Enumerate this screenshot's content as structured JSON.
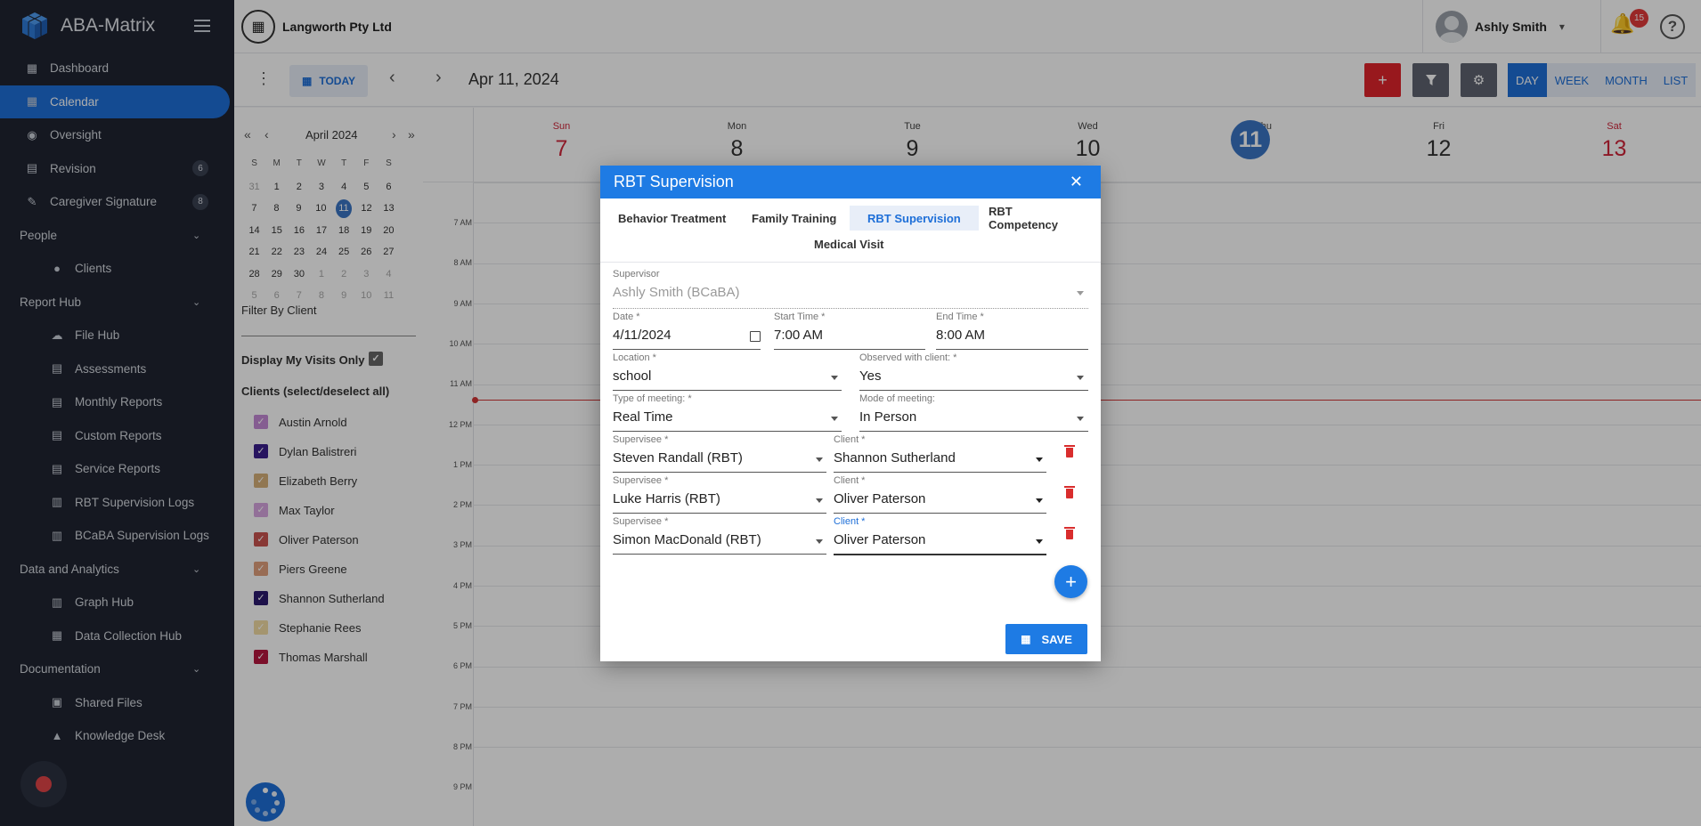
{
  "app": {
    "name": "ABA-Matrix"
  },
  "sidebar": {
    "items": [
      {
        "label": "Dashboard",
        "icon": "dashboard-icon",
        "kind": "top"
      },
      {
        "label": "Calendar",
        "icon": "calendar-icon",
        "kind": "top",
        "active": true
      },
      {
        "label": "Oversight",
        "icon": "eye-icon",
        "kind": "top"
      },
      {
        "label": "Revision",
        "icon": "revision-icon",
        "kind": "top",
        "badge": "6"
      },
      {
        "label": "Caregiver Signature",
        "icon": "signature-icon",
        "kind": "top",
        "badge": "8"
      },
      {
        "label": "People",
        "kind": "section"
      },
      {
        "label": "Clients",
        "icon": "person-icon",
        "kind": "sub"
      },
      {
        "label": "Report Hub",
        "kind": "section"
      },
      {
        "label": "File Hub",
        "icon": "cloud-icon",
        "kind": "sub"
      },
      {
        "label": "Assessments",
        "icon": "assessment-icon",
        "kind": "sub"
      },
      {
        "label": "Monthly Reports",
        "icon": "report-icon",
        "kind": "sub"
      },
      {
        "label": "Custom Reports",
        "icon": "report-icon",
        "kind": "sub"
      },
      {
        "label": "Service Reports",
        "icon": "service-icon",
        "kind": "sub"
      },
      {
        "label": "RBT Supervision Logs",
        "icon": "log-icon",
        "kind": "sub"
      },
      {
        "label": "BCaBA Supervision Logs",
        "icon": "log-icon",
        "kind": "sub"
      },
      {
        "label": "Data and Analytics",
        "kind": "section"
      },
      {
        "label": "Graph Hub",
        "icon": "graph-icon",
        "kind": "sub"
      },
      {
        "label": "Data Collection Hub",
        "icon": "data-icon",
        "kind": "sub"
      },
      {
        "label": "Documentation",
        "kind": "section"
      },
      {
        "label": "Shared Files",
        "icon": "shared-icon",
        "kind": "sub"
      },
      {
        "label": "Knowledge Desk",
        "icon": "knowledge-icon",
        "kind": "sub"
      }
    ]
  },
  "header": {
    "company": "Langworth Pty Ltd",
    "user": "Ashly Smith",
    "notifications": "15"
  },
  "toolbar": {
    "today_label": "TODAY",
    "current_date": "Apr 11, 2024",
    "views": [
      "DAY",
      "WEEK",
      "MONTH",
      "LIST"
    ],
    "selected_view": "DAY"
  },
  "mini_calendar": {
    "title": "April 2024",
    "dow": [
      "S",
      "M",
      "T",
      "W",
      "T",
      "F",
      "S"
    ],
    "weeks": [
      [
        "31",
        "1",
        "2",
        "3",
        "4",
        "5",
        "6"
      ],
      [
        "7",
        "8",
        "9",
        "10",
        "11",
        "12",
        "13"
      ],
      [
        "14",
        "15",
        "16",
        "17",
        "18",
        "19",
        "20"
      ],
      [
        "21",
        "22",
        "23",
        "24",
        "25",
        "26",
        "27"
      ],
      [
        "28",
        "29",
        "30",
        "1",
        "2",
        "3",
        "4"
      ],
      [
        "5",
        "6",
        "7",
        "8",
        "9",
        "10",
        "11"
      ]
    ],
    "selected": "11"
  },
  "filters": {
    "filter_by_client": "Filter By Client",
    "my_visits_label": "Display My Visits Only",
    "clients_header": "Clients (select/deselect all)",
    "clients": [
      {
        "name": "Austin Arnold",
        "color": "#c58ad6",
        "checked": true
      },
      {
        "name": "Dylan Balistreri",
        "color": "#3a1e8c",
        "checked": true
      },
      {
        "name": "Elizabeth Berry",
        "color": "#d6b07a",
        "checked": true
      },
      {
        "name": "Max Taylor",
        "color": "#d8a5e0",
        "checked": true
      },
      {
        "name": "Oliver Paterson",
        "color": "#c9534f",
        "checked": true
      },
      {
        "name": "Piers Greene",
        "color": "#e0a07c",
        "checked": true
      },
      {
        "name": "Shannon Sutherland",
        "color": "#2b1a6e",
        "checked": true
      },
      {
        "name": "Stephanie Rees",
        "color": "#f2dca4",
        "checked": true
      },
      {
        "name": "Thomas Marshall",
        "color": "#b5173f",
        "checked": true
      }
    ]
  },
  "week": {
    "days": [
      {
        "name": "Sun",
        "num": "7",
        "weekend": true
      },
      {
        "name": "Mon",
        "num": "8"
      },
      {
        "name": "Tue",
        "num": "9"
      },
      {
        "name": "Wed",
        "num": "10"
      },
      {
        "name": "Thu",
        "num": "11",
        "today": true
      },
      {
        "name": "Fri",
        "num": "12"
      },
      {
        "name": "Sat",
        "num": "13",
        "weekend": true
      }
    ],
    "hours": [
      "7 AM",
      "8 AM",
      "9 AM",
      "10 AM",
      "11 AM",
      "12 PM",
      "1 PM",
      "2 PM",
      "3 PM",
      "4 PM",
      "5 PM",
      "6 PM",
      "7 PM",
      "8 PM",
      "9 PM"
    ]
  },
  "modal": {
    "title": "RBT Supervision",
    "tabs": [
      "Behavior Treatment",
      "Family Training",
      "RBT Supervision",
      "RBT Competency",
      "Medical Visit"
    ],
    "active_tab": "RBT Supervision",
    "supervisor_label": "Supervisor",
    "supervisor_value": "Ashly Smith (BCaBA)",
    "date_label": "Date *",
    "date_value": "4/11/2024",
    "start_label": "Start Time *",
    "start_value": "7:00 AM",
    "end_label": "End Time *",
    "end_value": "8:00 AM",
    "location_label": "Location *",
    "location_value": "school",
    "observed_label": "Observed with client: *",
    "observed_value": "Yes",
    "type_label": "Type of meeting: *",
    "type_value": "Real Time",
    "mode_label": "Mode of meeting:",
    "mode_value": "In Person",
    "supervisee_label": "Supervisee *",
    "client_label": "Client *",
    "rows": [
      {
        "supervisee": "Steven Randall (RBT)",
        "client": "Shannon Sutherland"
      },
      {
        "supervisee": "Luke Harris (RBT)",
        "client": "Oliver Paterson"
      },
      {
        "supervisee": "Simon MacDonald (RBT)",
        "client": "Oliver Paterson"
      }
    ],
    "save_label": "SAVE"
  }
}
